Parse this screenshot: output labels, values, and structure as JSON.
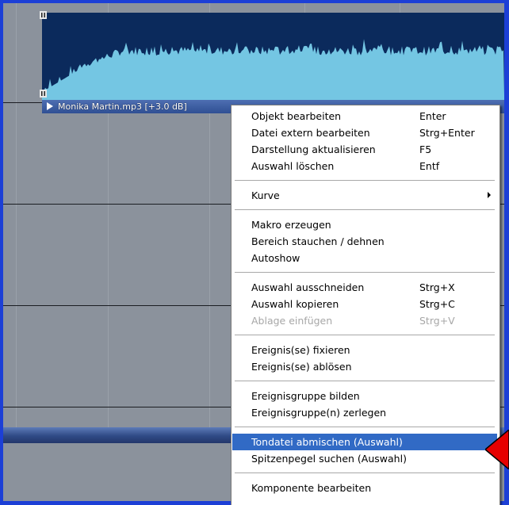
{
  "clip": {
    "label": "Monika Martin.mp3 [+3.0 dB]"
  },
  "context_menu": {
    "groups": [
      [
        {
          "label": "Objekt bearbeiten",
          "shortcut": "Enter",
          "enabled": true
        },
        {
          "label": "Datei extern bearbeiten",
          "shortcut": "Strg+Enter",
          "enabled": true
        },
        {
          "label": "Darstellung aktualisieren",
          "shortcut": "F5",
          "enabled": true
        },
        {
          "label": "Auswahl löschen",
          "shortcut": "Entf",
          "enabled": true
        }
      ],
      [
        {
          "label": "Kurve",
          "shortcut": "",
          "enabled": true,
          "submenu": true
        }
      ],
      [
        {
          "label": "Makro erzeugen",
          "shortcut": "",
          "enabled": true
        },
        {
          "label": "Bereich stauchen / dehnen",
          "shortcut": "",
          "enabled": true
        },
        {
          "label": "Autoshow",
          "shortcut": "",
          "enabled": true
        }
      ],
      [
        {
          "label": "Auswahl ausschneiden",
          "shortcut": "Strg+X",
          "enabled": true
        },
        {
          "label": "Auswahl kopieren",
          "shortcut": "Strg+C",
          "enabled": true
        },
        {
          "label": "Ablage einfügen",
          "shortcut": "Strg+V",
          "enabled": false
        }
      ],
      [
        {
          "label": "Ereignis(se) fixieren",
          "shortcut": "",
          "enabled": true
        },
        {
          "label": "Ereignis(se) ablösen",
          "shortcut": "",
          "enabled": true
        }
      ],
      [
        {
          "label": "Ereignisgruppe bilden",
          "shortcut": "",
          "enabled": true
        },
        {
          "label": "Ereignisgruppe(n) zerlegen",
          "shortcut": "",
          "enabled": true
        }
      ],
      [
        {
          "label": "Tondatei abmischen (Auswahl)",
          "shortcut": "",
          "enabled": true,
          "selected": true
        },
        {
          "label": "Spitzenpegel suchen (Auswahl)",
          "shortcut": "",
          "enabled": true
        }
      ],
      [
        {
          "label": "Komponente bearbeiten",
          "shortcut": "",
          "enabled": true
        }
      ]
    ]
  },
  "colors": {
    "window_border": "#1c3fd6",
    "waveform_background": "#0b2a5c",
    "waveform_fill": "#74c6e3",
    "selection": "#316ac5",
    "pointer_arrow": "#e60000"
  }
}
